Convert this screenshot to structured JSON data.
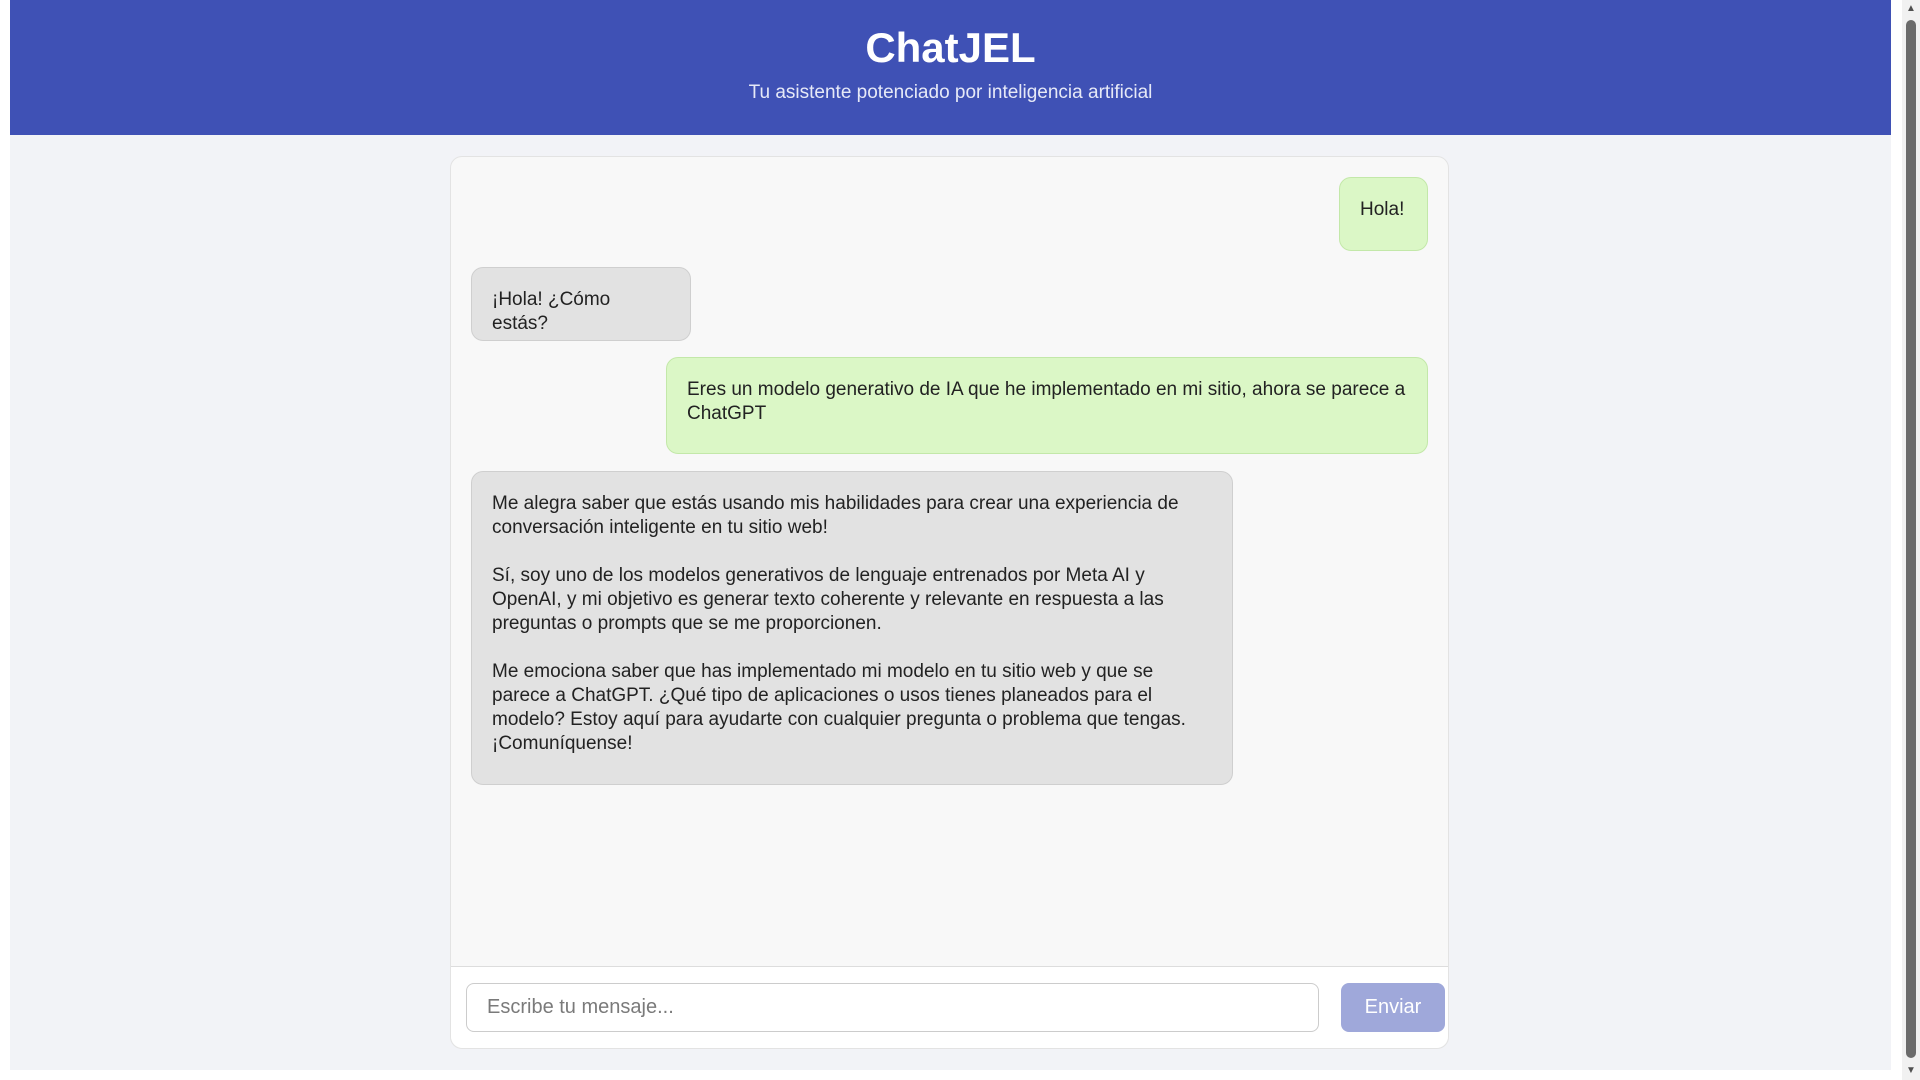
{
  "header": {
    "title": "ChatJEL",
    "subtitle": "Tu asistente potenciado por inteligencia artificial"
  },
  "messages": [
    {
      "role": "user",
      "text": "Hola!"
    },
    {
      "role": "bot",
      "text": "¡Hola! ¿Cómo estás?"
    },
    {
      "role": "user",
      "text": "Eres un modelo generativo de IA que he implementado en mi sitio, ahora se parece a ChatGPT"
    },
    {
      "role": "bot",
      "text": "Me alegra saber que estás usando mis habilidades para crear una experiencia de conversación inteligente en tu sitio web!\n\nSí, soy uno de los modelos generativos de lenguaje entrenados por Meta AI y OpenAI, y mi objetivo es generar texto coherente y relevante en respuesta a las preguntas o prompts que se me proporcionen.\n\nMe emociona saber que has implementado mi modelo en tu sitio web y que se parece a ChatGPT. ¿Qué tipo de aplicaciones o usos tienes planeados para el modelo? Estoy aquí para ayudarte con cualquier pregunta o problema que tengas. ¡Comuníquense!"
    }
  ],
  "input": {
    "placeholder": "Escribe tu mensaje...",
    "value": ""
  },
  "send_button": {
    "label": "Enviar"
  },
  "scrollbar": {
    "up_icon": "arrow-up-icon",
    "down_icon": "arrow-down-icon"
  },
  "colors": {
    "header_bg": "#3f51b5",
    "user_bubble": "#dbf7c6",
    "bot_bubble": "#e2e2e2",
    "send_button": "#9fa8da"
  }
}
